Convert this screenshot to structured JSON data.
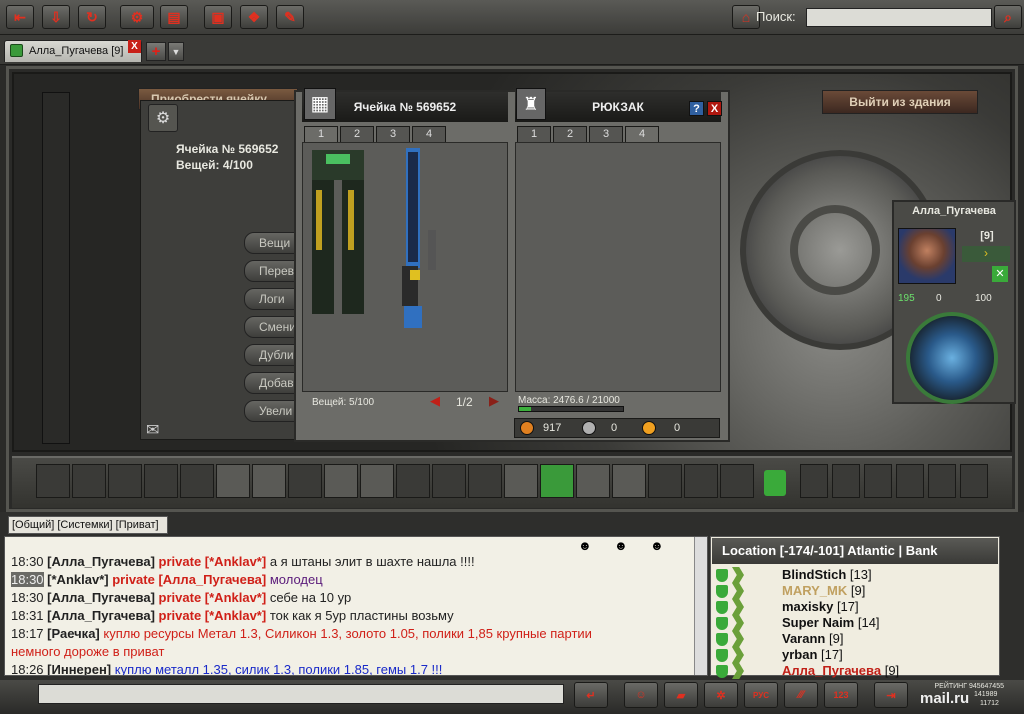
{
  "toolbar": {
    "search_label": "Поиск:"
  },
  "tabs": [
    {
      "label": "Алла_Пугачева [9]",
      "close": "X"
    }
  ],
  "scene": {
    "acquire_cell": "Приобрести ячейку",
    "exit_building": "Выйти из здания",
    "cell_title": "Ячейка № 569652",
    "cell_items": "Вещей: 4/100",
    "side_buttons": [
      "Вещи",
      "Перев",
      "Логи",
      "Смени",
      "Дубли",
      "Добав",
      "Увели"
    ]
  },
  "cell_window": {
    "title": "Ячейка № 569652",
    "tabs": [
      "1",
      "2",
      "3",
      "4"
    ],
    "items_footer": "Вещей: 5/100",
    "pager": "1/2"
  },
  "backpack": {
    "title": "РЮКЗАК",
    "help": "?",
    "close": "X",
    "tabs": [
      "1",
      "2",
      "3",
      "4"
    ],
    "mass_label": "Масса: 2476.6 / 21000",
    "mass_fraction": 0.118,
    "coins": [
      {
        "value": "917",
        "color": "#e08020"
      },
      {
        "value": "0",
        "color": "#b0b0b0"
      },
      {
        "value": "0",
        "color": "#f0a020"
      }
    ]
  },
  "character": {
    "name": "Алла_Пугачева",
    "level": "[9]",
    "hp": "195",
    "mp": "0",
    "ep": "100"
  },
  "chat": {
    "tabs_label": "[Общий] [Системки] [Приват]",
    "messages": [
      {
        "time": "18:30",
        "name": "[Алла_Пугачева]",
        "priv": "private [*Anklav*]",
        "text": " а я штаны элит в шахте нашла !!!!",
        "cls": "mt",
        "sel": false
      },
      {
        "time": "18:30",
        "name": "[*Anklav*]",
        "priv": "private [Алла_Пугачева]",
        "text": " молодец",
        "cls": "mp2",
        "sel": true
      },
      {
        "time": "18:30",
        "name": "[Алла_Пугачева]",
        "priv": "private [*Anklav*]",
        "text": " себе на 10 ур",
        "cls": "mt",
        "sel": false
      },
      {
        "time": "18:31",
        "name": "[Алла_Пугачева]",
        "priv": "private [*Anklav*]",
        "text": " ток как я 5ур пластины возьму",
        "cls": "mt",
        "sel": false
      },
      {
        "time": "18:17",
        "name": "[Раечка]",
        "priv": "",
        "text": " куплю ресурсы Метал 1.3, Силикон 1.3, золото 1.05, полики 1,85 крупные партии",
        "cls": "mr",
        "sel": false
      },
      {
        "time": "",
        "name": "",
        "priv": "",
        "text": "немного дороже в приват",
        "cls": "mr",
        "sel": false
      },
      {
        "time": "18:26",
        "name": "[Иннерен]",
        "priv": "",
        "text": " куплю металл 1.35, силик 1.3, полики 1.85, гемы 1.7 !!!",
        "cls": "mb",
        "sel": false
      }
    ]
  },
  "location": {
    "title": "Location [-174/-101] Atlantic | Bank",
    "players": [
      {
        "name": "BlindStich",
        "level": "[13]"
      },
      {
        "name": "MARY_MK",
        "level": "[9]",
        "color": "#c0a060"
      },
      {
        "name": "maxisky",
        "level": "[17]"
      },
      {
        "name": "Super Naim",
        "level": "[14]"
      },
      {
        "name": "Varann",
        "level": "[9]"
      },
      {
        "name": "yrban",
        "level": "[17]"
      },
      {
        "name": "Алла_Пугачева",
        "level": "[9]",
        "color": "#c02018"
      }
    ]
  },
  "footer": {
    "rating": "РЕЙТИНГ 945647455",
    "c1": "141989",
    "c2": "11712",
    "brand": "mail.ru"
  }
}
